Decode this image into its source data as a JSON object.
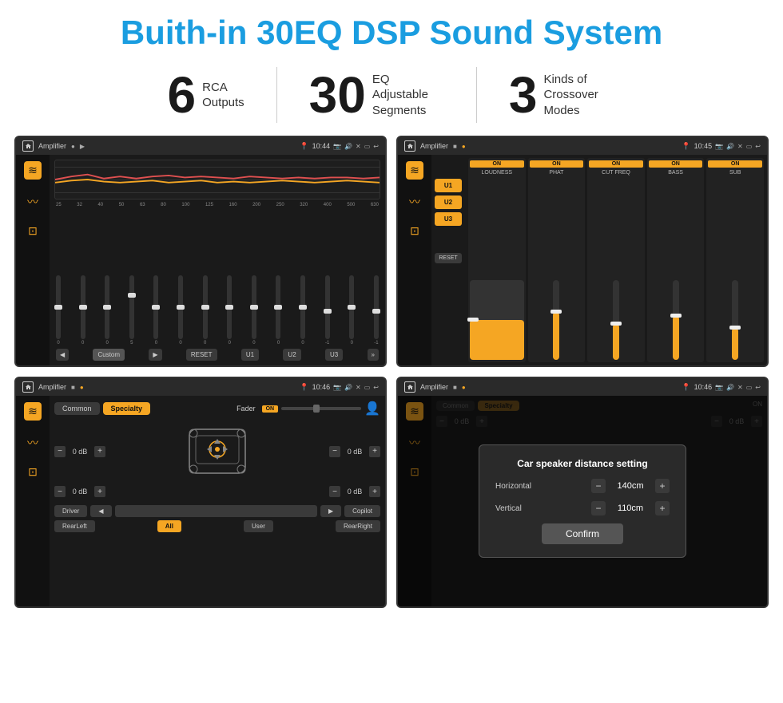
{
  "header": {
    "title": "Buith-in 30EQ DSP Sound System"
  },
  "stats": [
    {
      "number": "6",
      "text": "RCA\nOutputs"
    },
    {
      "number": "30",
      "text": "EQ Adjustable\nSegments"
    },
    {
      "number": "3",
      "text": "Kinds of\nCrossover Modes"
    }
  ],
  "screens": [
    {
      "id": "screen1",
      "statusbar": {
        "appName": "Amplifier",
        "time": "10:44"
      },
      "eqFreqs": [
        "25",
        "32",
        "40",
        "50",
        "63",
        "80",
        "100",
        "125",
        "160",
        "200",
        "250",
        "320",
        "400",
        "500",
        "630"
      ],
      "eqValues": [
        "0",
        "0",
        "0",
        "5",
        "0",
        "0",
        "0",
        "0",
        "0",
        "0",
        "0",
        "-1",
        "0",
        "-1"
      ],
      "bottomBtns": [
        "Custom",
        "RESET",
        "U1",
        "U2",
        "U3"
      ]
    },
    {
      "id": "screen2",
      "statusbar": {
        "appName": "Amplifier",
        "time": "10:45"
      },
      "presets": [
        "U1",
        "U2",
        "U3"
      ],
      "channels": [
        {
          "on": true,
          "name": "LOUDNESS"
        },
        {
          "on": true,
          "name": "PHAT"
        },
        {
          "on": true,
          "name": "CUT FREQ"
        },
        {
          "on": true,
          "name": "BASS"
        },
        {
          "on": true,
          "name": "SUB"
        }
      ]
    },
    {
      "id": "screen3",
      "statusbar": {
        "appName": "Amplifier",
        "time": "10:46"
      },
      "tabs": [
        "Common",
        "Specialty"
      ],
      "faderLabel": "Fader",
      "faderOn": "ON",
      "volTopLeft": "0 dB",
      "volTopRight": "0 dB",
      "volBotLeft": "0 dB",
      "volBotRight": "0 dB",
      "bottomBtns": [
        "Driver",
        "",
        "Copilot",
        "RearLeft",
        "All",
        "User",
        "RearRight"
      ]
    },
    {
      "id": "screen4",
      "statusbar": {
        "appName": "Amplifier",
        "time": "10:46"
      },
      "dialog": {
        "title": "Car speaker distance setting",
        "horizontal": {
          "label": "Horizontal",
          "value": "140cm"
        },
        "vertical": {
          "label": "Vertical",
          "value": "110cm"
        },
        "confirmLabel": "Confirm"
      }
    }
  ]
}
